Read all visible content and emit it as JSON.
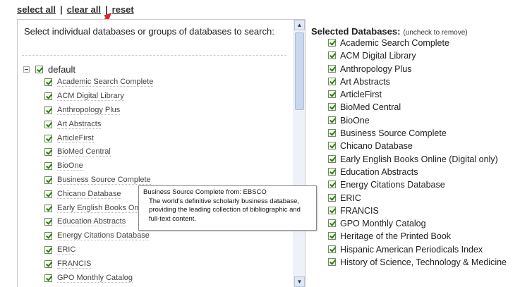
{
  "toolbar": {
    "select_all": "select all",
    "sep1": "|",
    "clear_all": "clear all",
    "sep2": "|",
    "reset": "reset"
  },
  "left_panel": {
    "instructions": "Select individual databases or groups of databases to search:",
    "group_label": "default",
    "items": [
      "Academic Search Complete",
      "ACM Digital Library",
      "Anthropology Plus",
      "Art Abstracts",
      "ArticleFirst",
      "BioMed Central",
      "BioOne",
      "Business Source Complete",
      "Chicano Database",
      "Early English Books Online (Digital only)",
      "Education Abstracts",
      "Energy Citations Database",
      "ERIC",
      "FRANCIS",
      "GPO Monthly Catalog"
    ]
  },
  "tooltip": {
    "title": "Business Source Complete from: EBSCO",
    "body": "The world's definitive scholarly business database, providing the leading collection of bibliographic and full-text content."
  },
  "right_panel": {
    "heading": "Selected Databases:",
    "hint": "(uncheck to remove)",
    "items": [
      "Academic Search Complete",
      "ACM Digital Library",
      "Anthropology Plus",
      "Art Abstracts",
      "ArticleFirst",
      "BioMed Central",
      "BioOne",
      "Business Source Complete",
      "Chicano Database",
      "Early English Books Online (Digital only)",
      "Education Abstracts",
      "Energy Citations Database",
      "ERIC",
      "FRANCIS",
      "GPO Monthly Catalog",
      "Heritage of the Printed Book",
      "Hispanic American Periodicals Index",
      "History of Science, Technology & Medicine"
    ]
  },
  "colors": {
    "checkbox": "#2d7a14",
    "annotation_arrow": "#e0252b"
  }
}
